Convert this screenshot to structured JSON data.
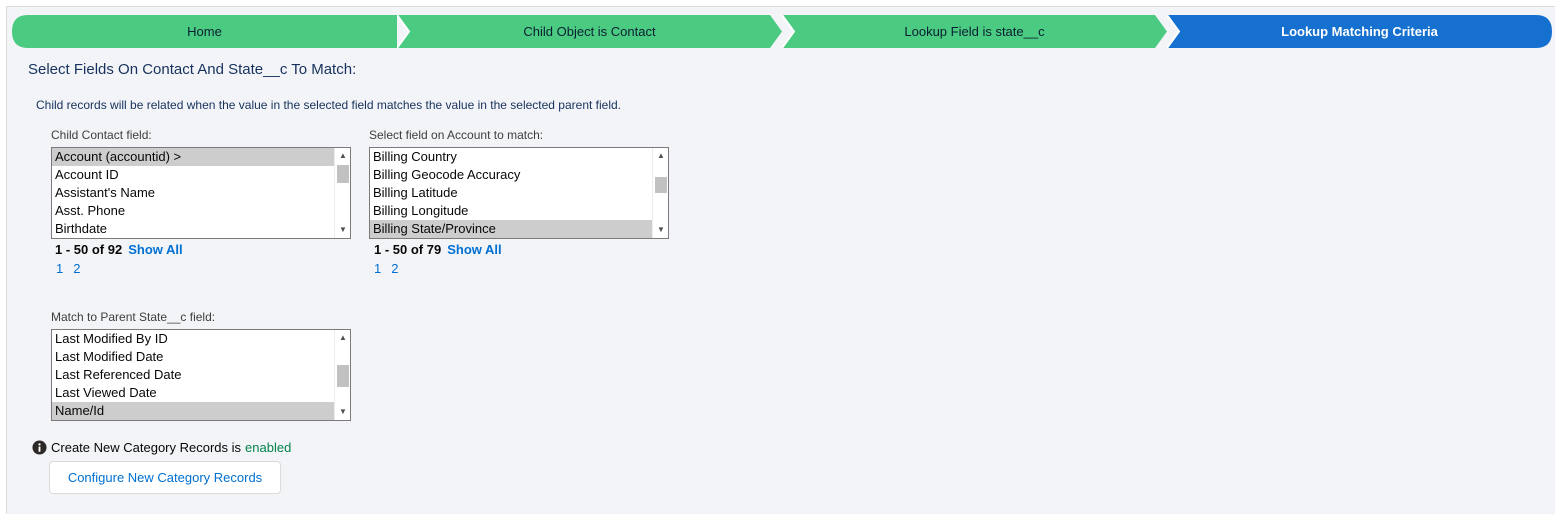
{
  "path": {
    "steps": [
      {
        "label": "Home",
        "state": "complete"
      },
      {
        "label": "Child Object is Contact",
        "state": "complete"
      },
      {
        "label": "Lookup Field is state__c",
        "state": "complete"
      },
      {
        "label": "Lookup Matching Criteria",
        "state": "current"
      }
    ],
    "colors": {
      "complete": "#4bca81",
      "current": "#1570cf"
    }
  },
  "heading": "Select Fields On Contact And State__c To Match:",
  "description": "Child records will be related when the value in the selected field matches the value in the selected parent field.",
  "child_field": {
    "label": "Child Contact field:",
    "options": [
      {
        "text": "Account (accountid) >",
        "selected": true
      },
      {
        "text": "Account ID",
        "selected": false
      },
      {
        "text": "Assistant's Name",
        "selected": false
      },
      {
        "text": "Asst. Phone",
        "selected": false
      },
      {
        "text": "Birthdate",
        "selected": false
      }
    ],
    "range": "1 - 50 of 92",
    "show_all": "Show All",
    "pages": [
      "1",
      "2"
    ]
  },
  "account_field": {
    "label": "Select field on Account to match:",
    "options": [
      {
        "text": "Billing Country",
        "selected": false
      },
      {
        "text": "Billing Geocode Accuracy",
        "selected": false
      },
      {
        "text": "Billing Latitude",
        "selected": false
      },
      {
        "text": "Billing Longitude",
        "selected": false
      },
      {
        "text": "Billing State/Province",
        "selected": true
      }
    ],
    "range": "1 - 50 of 79",
    "show_all": "Show All",
    "pages": [
      "1",
      "2"
    ]
  },
  "parent_field": {
    "label": "Match to Parent State__c field:",
    "options": [
      {
        "text": "Last Modified By ID",
        "selected": false
      },
      {
        "text": "Last Modified Date",
        "selected": false
      },
      {
        "text": "Last Referenced Date",
        "selected": false
      },
      {
        "text": "Last Viewed Date",
        "selected": false
      },
      {
        "text": "Name/Id",
        "selected": true
      }
    ]
  },
  "info": {
    "icon": "info-icon",
    "text": "Create New Category Records is",
    "status": "enabled",
    "status_color": "#04844b"
  },
  "configure_button": "Configure New Category Records"
}
